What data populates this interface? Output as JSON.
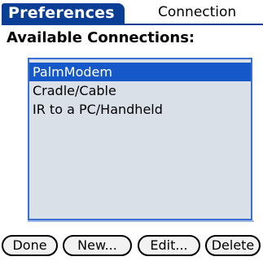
{
  "header": {
    "title": "Preferences",
    "category": "Connection"
  },
  "section": {
    "label": "Available Connections:"
  },
  "connections": [
    {
      "label": "PalmModem",
      "selected": true
    },
    {
      "label": "Cradle/Cable",
      "selected": false
    },
    {
      "label": "IR to a PC/Handheld",
      "selected": false
    }
  ],
  "buttons": {
    "done": "Done",
    "new": "New...",
    "edit": "Edit...",
    "delete": "Delete"
  },
  "colors": {
    "title_bar": "#0a3d96",
    "selection": "#1458c9",
    "list_background": "#d9e0e8"
  }
}
